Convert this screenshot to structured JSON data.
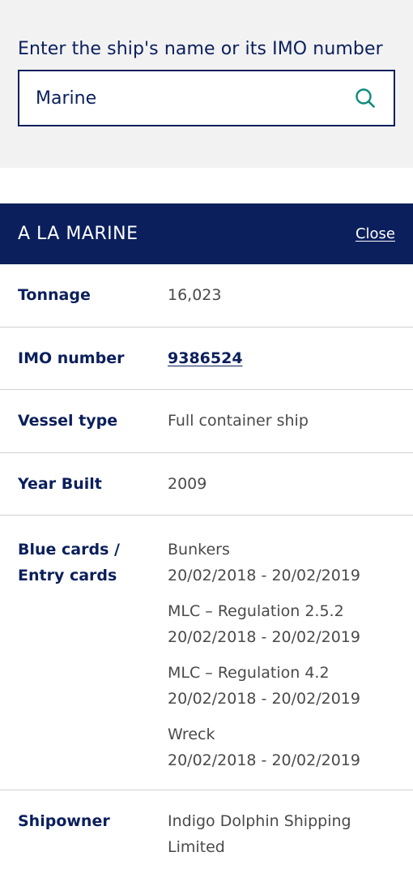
{
  "search": {
    "label": "Enter the ship's name or its IMO number",
    "value": "Marine",
    "icon": "search-icon"
  },
  "details": {
    "ship_name": "A LA MARINE",
    "close_label": "Close",
    "rows": {
      "tonnage": {
        "label": "Tonnage",
        "value": "16,023"
      },
      "imo": {
        "label": "IMO number",
        "value": "9386524"
      },
      "vessel_type": {
        "label": "Vessel type",
        "value": "Full container ship"
      },
      "year_built": {
        "label": "Year Built",
        "value": "2009"
      },
      "cards": {
        "label_line1": "Blue cards /",
        "label_line2": "Entry cards",
        "entries": [
          {
            "name": "Bunkers",
            "period": "20/02/2018 - 20/02/2019"
          },
          {
            "name": "MLC – Regulation 2.5.2",
            "period": "20/02/2018 - 20/02/2019"
          },
          {
            "name": "MLC – Regulation 4.2",
            "period": "20/02/2018 - 20/02/2019"
          },
          {
            "name": "Wreck",
            "period": "20/02/2018 - 20/02/2019"
          }
        ]
      },
      "shipowner": {
        "label": "Shipowner",
        "value_line1": "Indigo Dolphin Shipping",
        "value_line2": "Limited"
      }
    }
  },
  "colors": {
    "navy": "#0a1f5c",
    "teal_icon": "#0f8a7e",
    "gray_bg": "#f2f2f2",
    "divider": "#d0d0d0"
  }
}
